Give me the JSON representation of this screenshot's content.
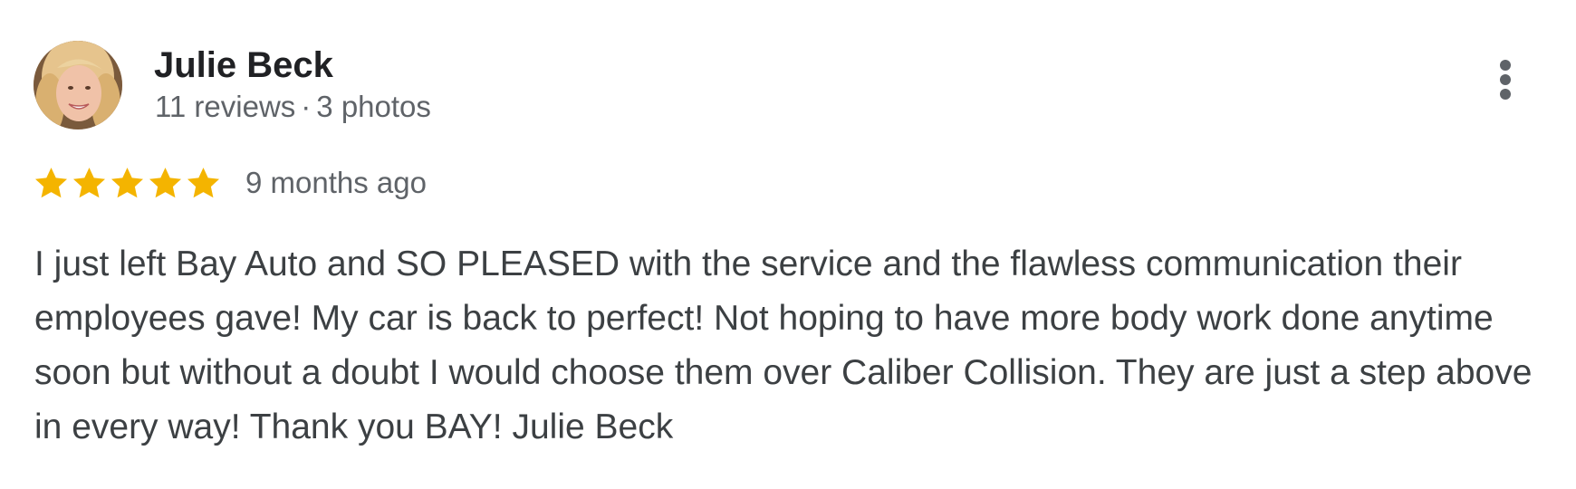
{
  "reviewer": {
    "name": "Julie Beck",
    "reviews_count": "11 reviews",
    "separator": "·",
    "photos_count": "3 photos"
  },
  "rating": {
    "stars": 5,
    "max_stars": 5,
    "star_color": "#f4b400",
    "time": "9 months ago"
  },
  "review": {
    "text": "I just left Bay Auto and SO PLEASED with the service and the flawless communication their employees gave! My car is back to perfect! Not hoping to have more body work done anytime soon but without a doubt I would choose them over Caliber Collision. They are just a step above in every way! Thank you BAY! Julie Beck"
  },
  "icons": {
    "avatar": "reviewer-avatar-photo",
    "menu": "more-vert-icon",
    "star": "star-icon"
  }
}
